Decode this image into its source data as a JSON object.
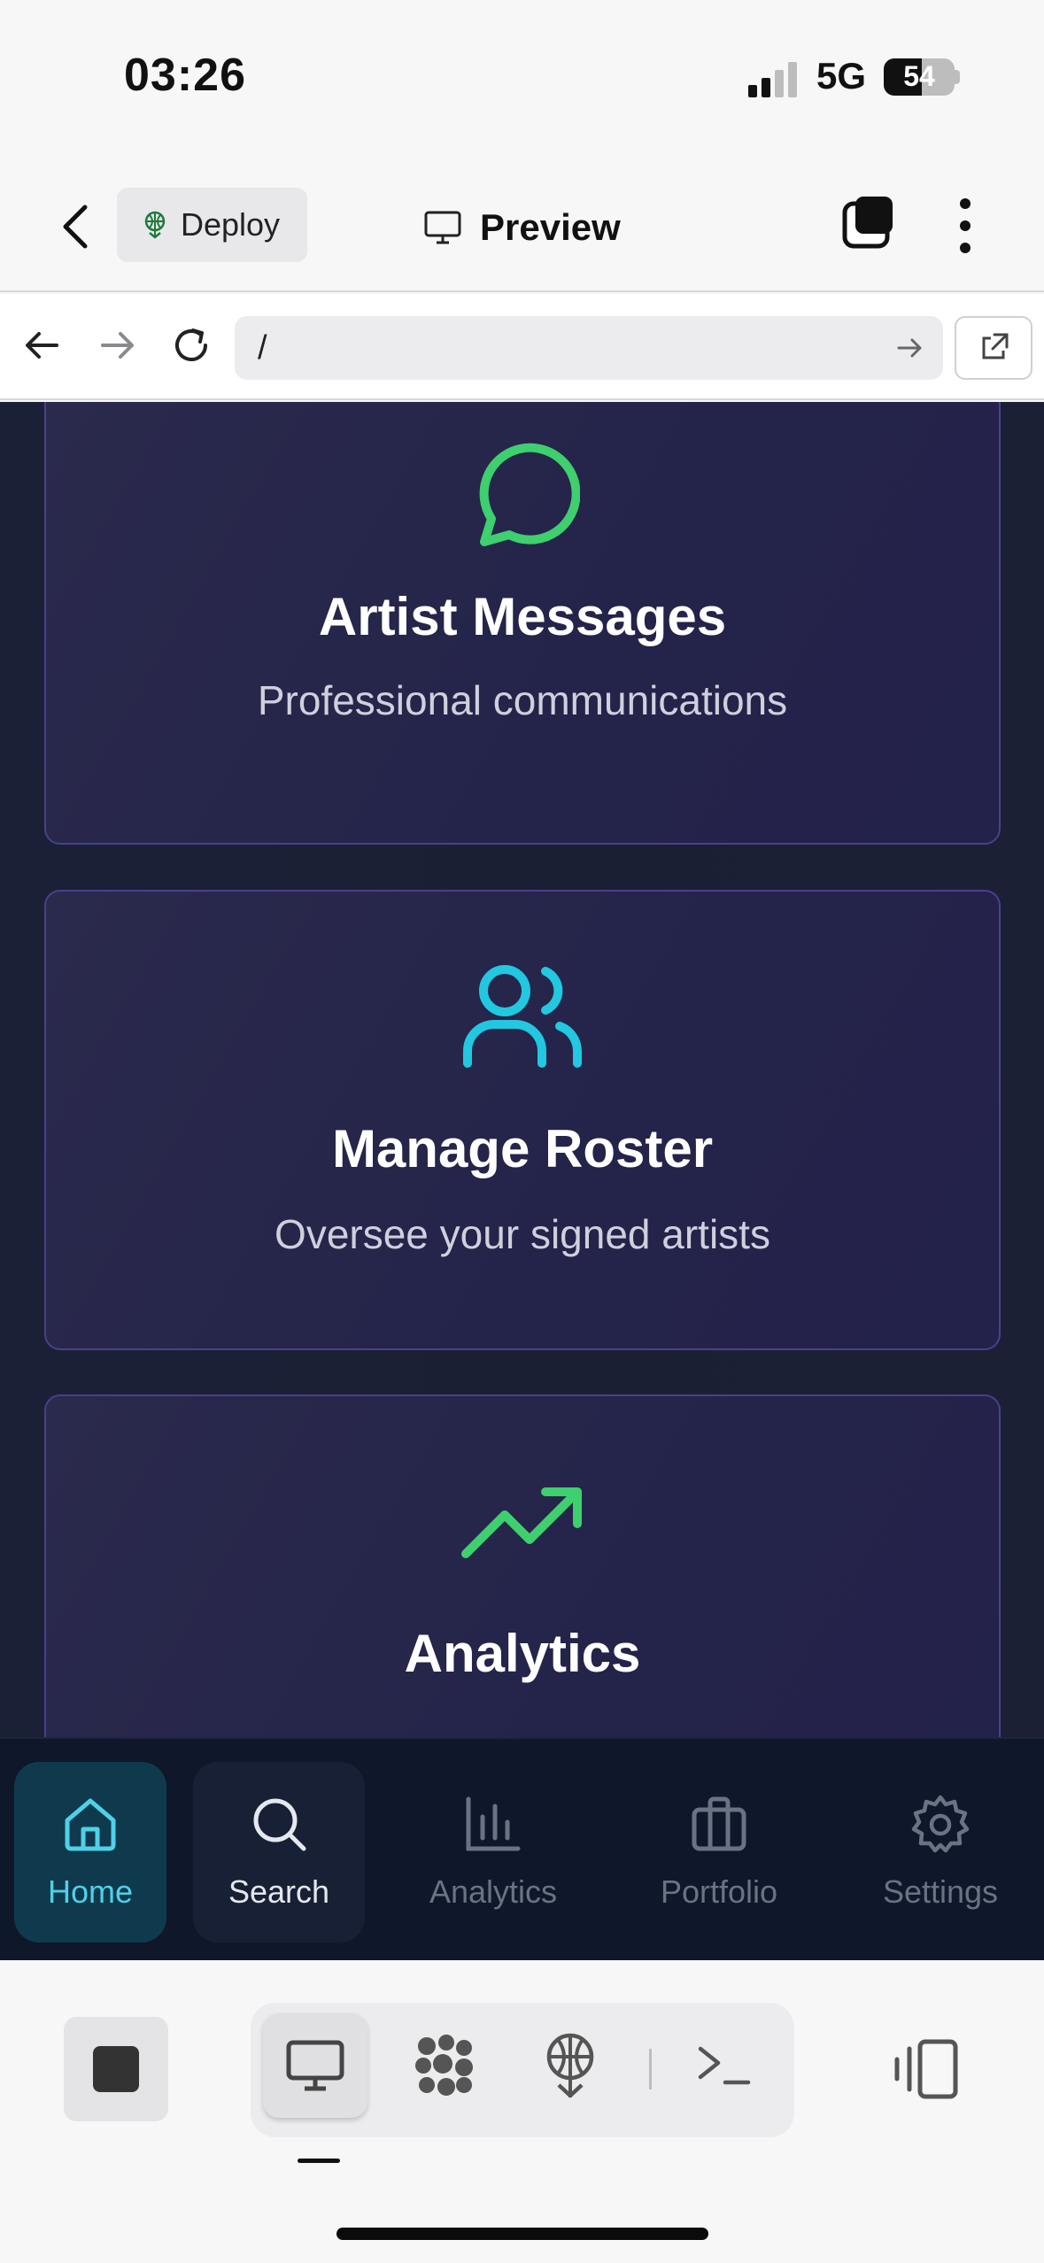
{
  "status_bar": {
    "time": "03:26",
    "network": "5G",
    "battery": "54"
  },
  "toolbar": {
    "deploy_label": "Deploy",
    "preview_label": "Preview"
  },
  "browser": {
    "url": "/"
  },
  "cards": [
    {
      "title": "Artist Messages",
      "subtitle": "Professional communications",
      "icon": "message-circle-icon",
      "icon_color": "#3ecf6e"
    },
    {
      "title": "Manage Roster",
      "subtitle": "Oversee your signed artists",
      "icon": "users-icon",
      "icon_color": "#22c7e0"
    },
    {
      "title": "Analytics",
      "subtitle": "",
      "icon": "trending-up-icon",
      "icon_color": "#3ecf6e"
    }
  ],
  "app_nav": {
    "items": [
      {
        "label": "Home",
        "icon": "home-icon",
        "state": "active"
      },
      {
        "label": "Search",
        "icon": "search-icon",
        "state": "highlighted"
      },
      {
        "label": "Analytics",
        "icon": "bar-chart-icon",
        "state": "inactive"
      },
      {
        "label": "Portfolio",
        "icon": "briefcase-icon",
        "state": "inactive"
      },
      {
        "label": "Settings",
        "icon": "settings-icon",
        "state": "inactive"
      }
    ]
  },
  "colors": {
    "accent_cyan": "#4fd1e8",
    "accent_green": "#3ecf6e",
    "card_border": "#4a3f8e",
    "background": "#1b2034"
  }
}
